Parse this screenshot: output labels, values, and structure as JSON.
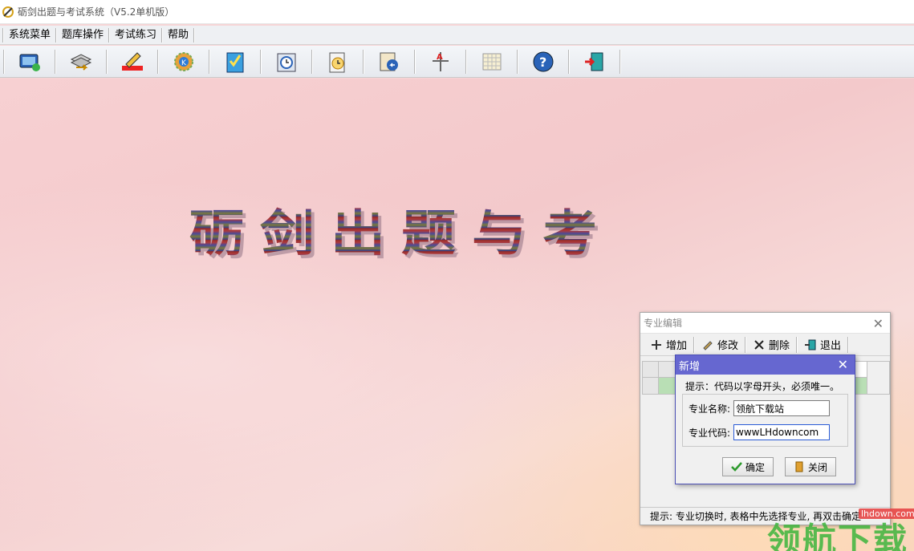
{
  "window": {
    "title": "砺剑出题与考试系统（V5.2单机版）"
  },
  "menu": {
    "items": [
      "系统菜单",
      "题库操作",
      "考试练习",
      "帮助"
    ]
  },
  "toolbar": {
    "icons": [
      "monitor-icon",
      "database-transfer-icon",
      "pencil-edit-icon",
      "settings-k-icon",
      "checklist-icon",
      "calendar-clock-icon",
      "document-clock-icon",
      "back-clock-icon",
      "tree-a-icon",
      "grid-sheet-icon",
      "help-icon",
      "exit-door-icon"
    ]
  },
  "banner": {
    "text": "砺剑出题与考"
  },
  "outer_dialog": {
    "title": "专业编辑",
    "toolbar": {
      "add": "增加",
      "edit": "修改",
      "delete": "删除",
      "exit": "退出"
    },
    "status": "提示: 专业切换时, 表格中先选择专业, 再双击确定"
  },
  "inner_dialog": {
    "title": "新增",
    "hint": "提示：代码以字母开头，必须唯一。",
    "name_label": "专业名称:",
    "name_value": "领航下载站",
    "code_label": "专业代码:",
    "code_value": "wwwLHdowncom",
    "ok_label": "确定",
    "close_label": "关闭"
  },
  "watermark": {
    "site": "lhdown.com",
    "text": "领航下载"
  }
}
